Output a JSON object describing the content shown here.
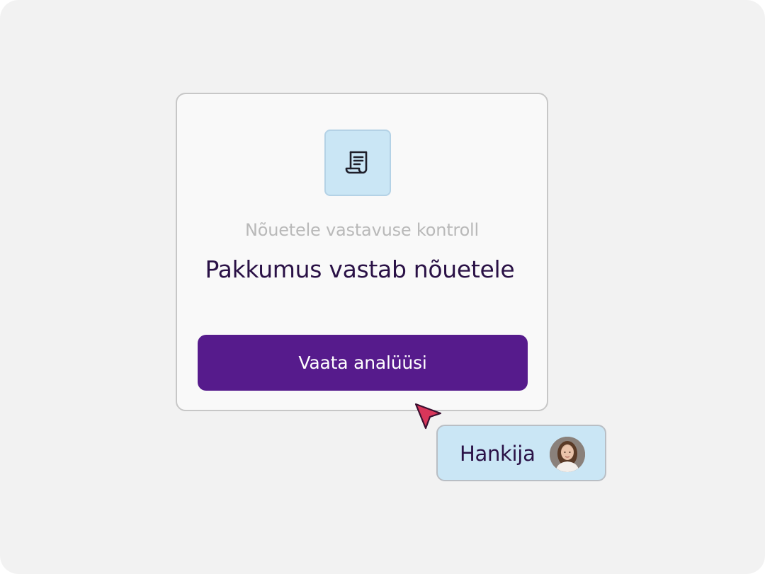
{
  "card": {
    "icon": "document-scroll-icon",
    "subtitle": "Nõuetele vastavuse kontroll",
    "title": "Pakkumus vastab nõuetele",
    "button_label": "Vaata analüüsi"
  },
  "cursor": {
    "icon": "pointer-cursor-icon",
    "color": "#d9365a"
  },
  "user": {
    "name": "Hankija",
    "avatar": "user-avatar-photo"
  },
  "colors": {
    "background": "#f2f2f2",
    "card_bg": "#f9f9f9",
    "accent": "#561b8c",
    "icon_bg": "#cae6f5",
    "text_dark": "#2a1146",
    "text_muted": "#b9b9b9"
  }
}
